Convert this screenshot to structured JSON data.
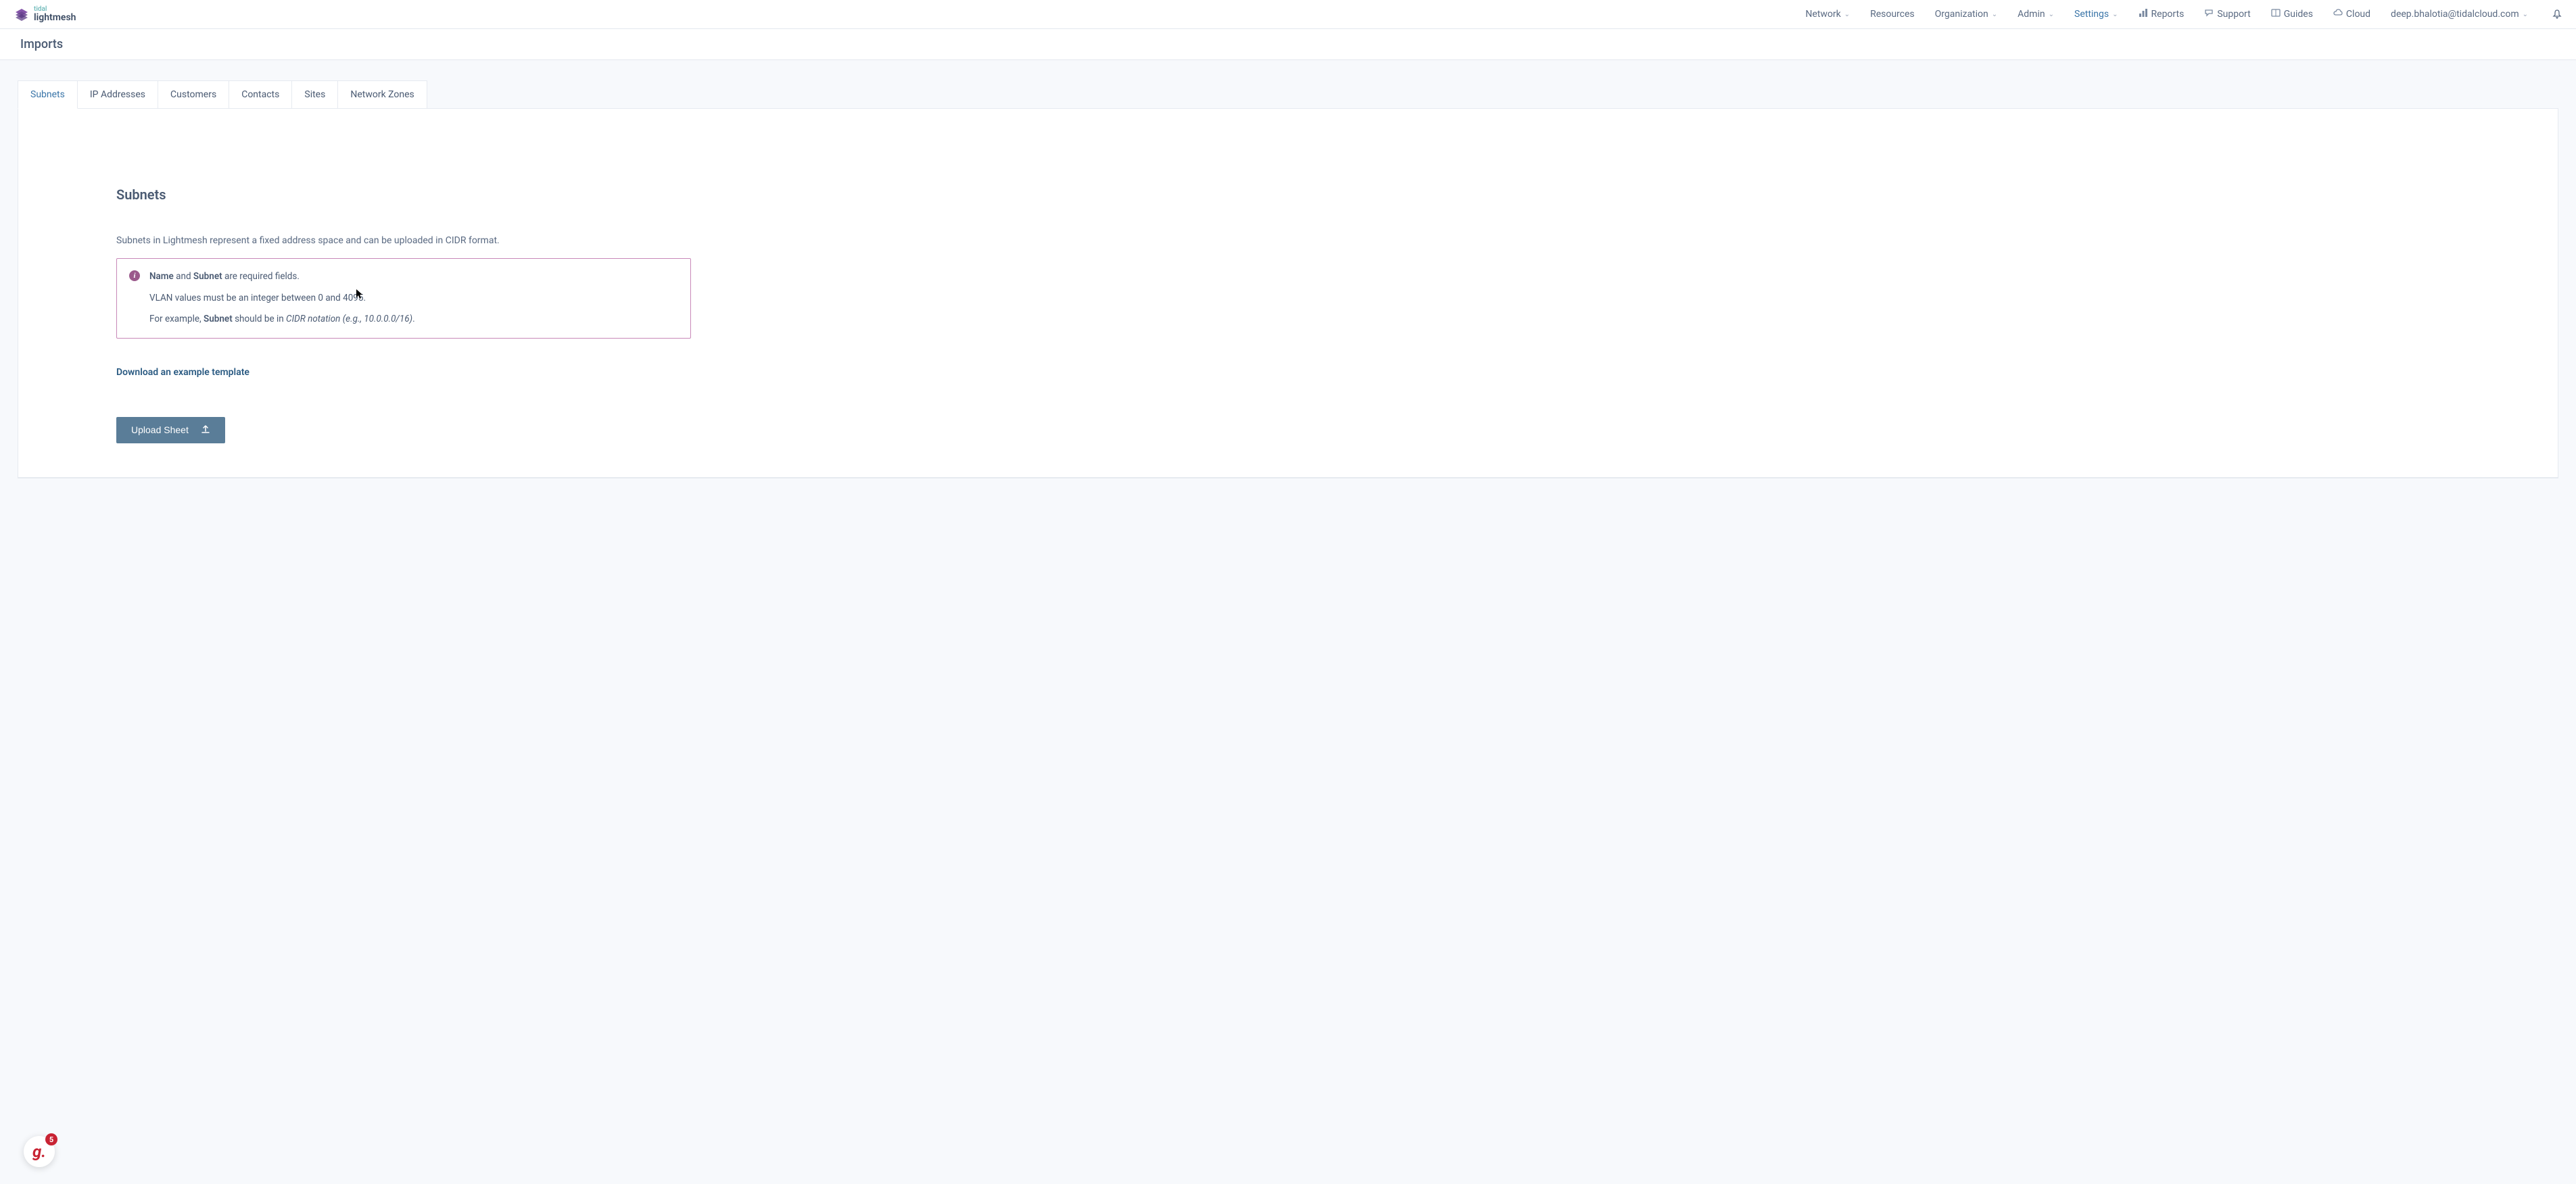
{
  "logo": {
    "tidal": "tidal",
    "lightmesh": "lightmesh"
  },
  "nav": {
    "network": "Network",
    "resources": "Resources",
    "organization": "Organization",
    "admin": "Admin",
    "settings": "Settings",
    "reports": "Reports",
    "support": "Support",
    "guides": "Guides",
    "cloud": "Cloud",
    "user_email": "deep.bhalotia@tidalcloud.com"
  },
  "page": {
    "title": "Imports"
  },
  "tabs": [
    {
      "label": "Subnets",
      "active": true
    },
    {
      "label": "IP Addresses",
      "active": false
    },
    {
      "label": "Customers",
      "active": false
    },
    {
      "label": "Contacts",
      "active": false
    },
    {
      "label": "Sites",
      "active": false
    },
    {
      "label": "Network Zones",
      "active": false
    }
  ],
  "content": {
    "section_title": "Subnets",
    "description": "Subnets in Lightmesh represent a fixed address space and can be uploaded in CIDR format.",
    "info": {
      "line1_b1": "Name",
      "line1_mid": " and ",
      "line1_b2": "Subnet",
      "line1_end": " are required fields.",
      "line2": "VLAN values must be an integer between 0 and 4095.",
      "line3_start": "For example, ",
      "line3_b": "Subnet",
      "line3_mid": " should be in ",
      "line3_i": "CIDR notation (e.g., 10.0.0.0/16)",
      "line3_end": "."
    },
    "download_link": "Download an example template",
    "upload_button": "Upload Sheet"
  },
  "widget": {
    "badge": "5"
  }
}
